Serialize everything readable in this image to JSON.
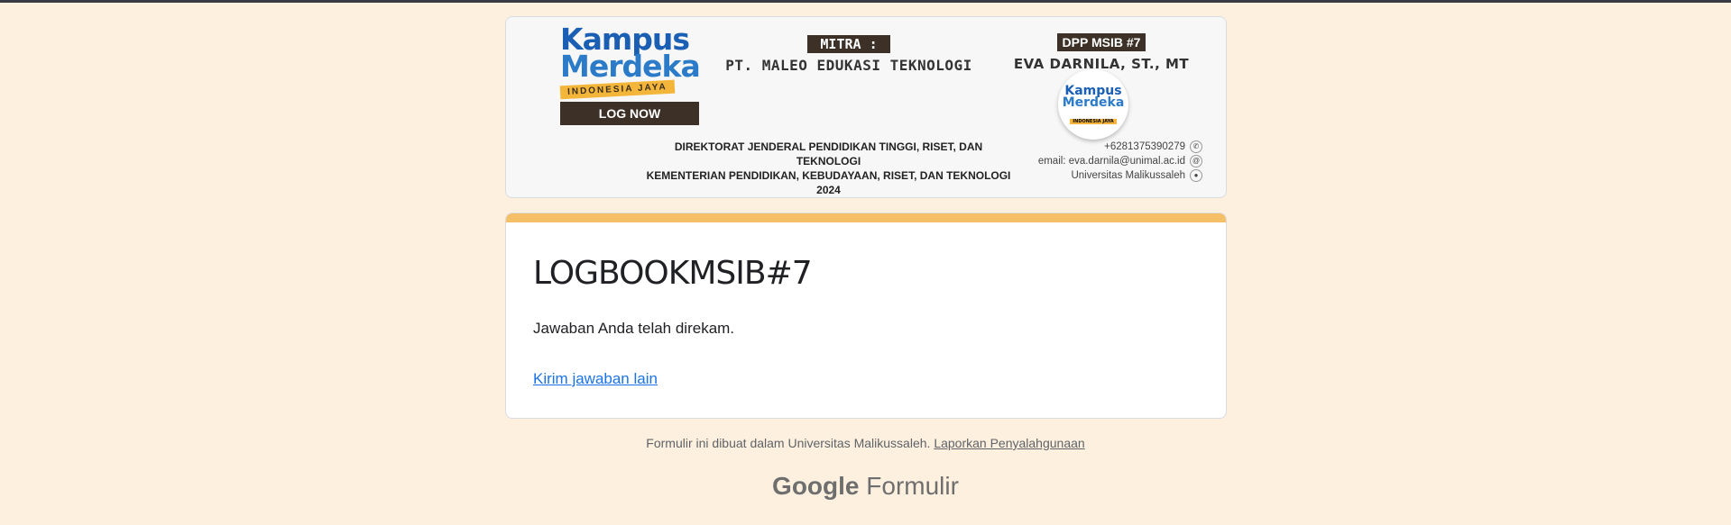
{
  "banner": {
    "logo": {
      "line1": "Kampus",
      "line2": "Merdeka",
      "ribbon": "INDONESIA JAYA",
      "button": "LOG NOW"
    },
    "mitra_tag": "MITRA :",
    "mitra_name": "PT. MALEO EDUKASI TEKNOLOGI",
    "dpp_tag": "DPP MSIB #7",
    "dpp_name": "EVA DARNILA, ST., MT",
    "circle_logo": {
      "line1": "Kampus",
      "line2": "Merdeka",
      "ribbon": "INDONESIA JAYA"
    },
    "dirjen_line1": "DIREKTORAT JENDERAL PENDIDIKAN TINGGI, RISET, DAN TEKNOLOGI",
    "dirjen_line2": "KEMENTERIAN PENDIDIKAN, KEBUDAYAAN, RISET, DAN TEKNOLOGI",
    "dirjen_year": "2024",
    "phone": "+6281375390279",
    "email": "email: eva.darnila@unimal.ac.id",
    "university": "Universitas Malikussaleh"
  },
  "form": {
    "title": "LOGBOOKMSIB#7",
    "message": "Jawaban Anda telah direkam.",
    "another_link": "Kirim jawaban lain",
    "accent_color": "#f4bf66"
  },
  "footer": {
    "note": "Formulir ini dibuat dalam Universitas Malikussaleh.",
    "report_link": "Laporkan Penyalahgunaan"
  },
  "brand": {
    "google": "Google",
    "product": "Formulir"
  }
}
